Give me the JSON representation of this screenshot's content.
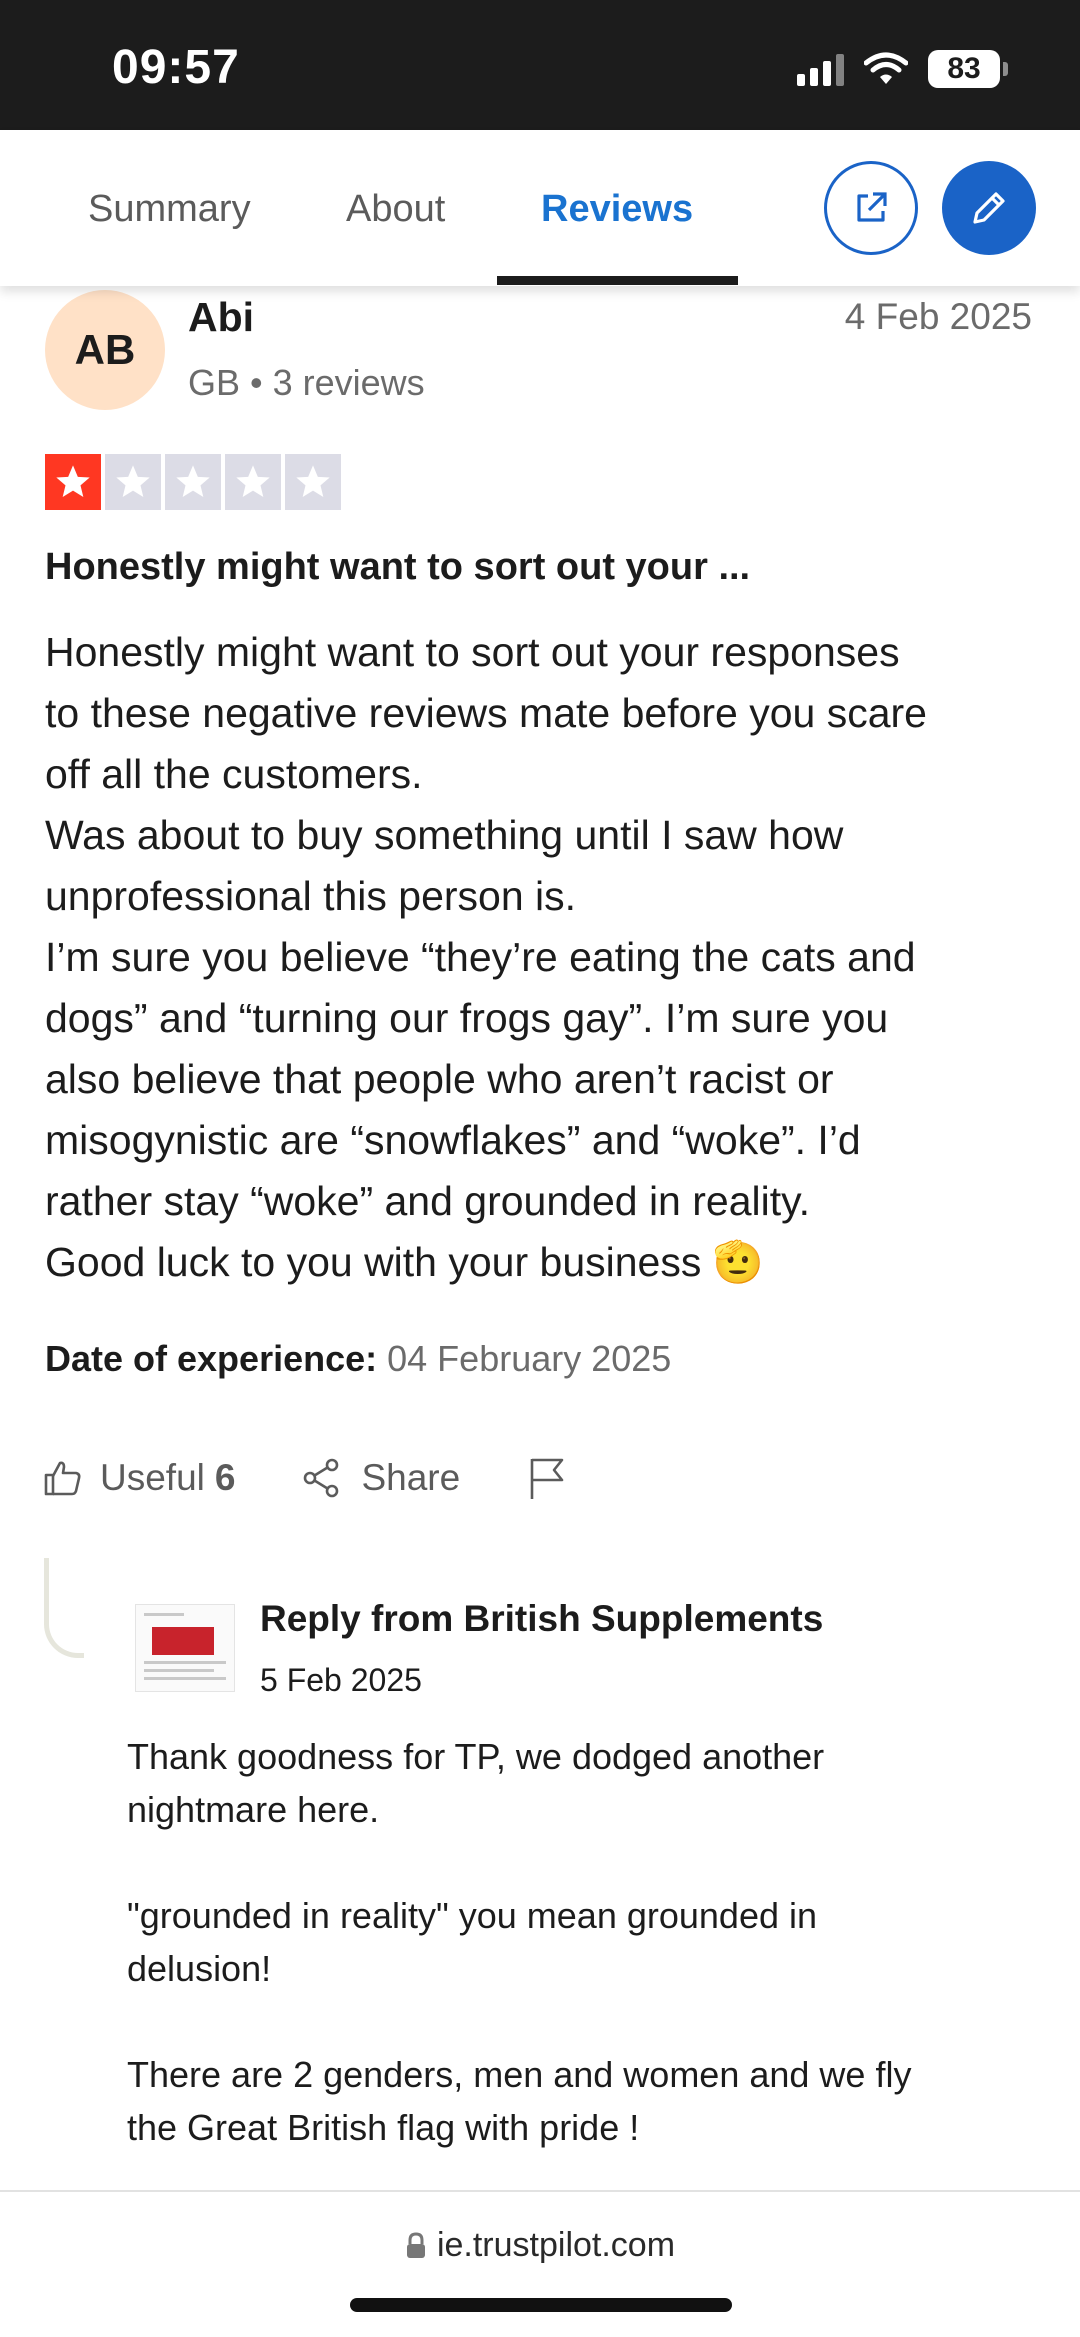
{
  "status_bar": {
    "time": "09:57",
    "battery": "83"
  },
  "nav": {
    "tabs": [
      {
        "label": "Summary"
      },
      {
        "label": "About"
      },
      {
        "label": "Reviews"
      }
    ],
    "active_tab": "Reviews",
    "external_icon": "external-link-icon",
    "write_icon": "pencil-icon",
    "accent": "#1a63c7"
  },
  "review": {
    "initials": "AB",
    "name": "Abi",
    "meta": "GB • 3 reviews",
    "date": "4 Feb 2025",
    "rating": 1,
    "rating_max": 5,
    "star_color": "#ff3722",
    "title": "Honestly might want to sort out your ...",
    "body_lines": [
      "Honestly might want to sort out your responses",
      "to these negative reviews mate before you scare",
      "off all the customers.",
      "Was about to buy something until I saw how",
      "unprofessional this person is.",
      "I’m sure you believe “they’re eating the cats and",
      "dogs” and “turning our frogs gay”. I’m sure you",
      "also believe that people who aren’t racist or",
      "misogynistic are “snowflakes” and “woke”. I’d",
      "rather stay “woke” and grounded in reality.",
      "Good luck to you with your business 🫡"
    ],
    "date_of_experience_label": "Date of experience:",
    "date_of_experience_value": "04 February 2025",
    "useful_label": "Useful",
    "useful_count": "6",
    "share_label": "Share"
  },
  "reply": {
    "from": "Reply from British Supplements",
    "date": "5 Feb 2025",
    "para1_lines": [
      "Thank goodness for TP, we dodged another",
      "nightmare here."
    ],
    "para2_lines": [
      "\"grounded in reality\" you mean grounded in",
      "delusion!"
    ],
    "para3_lines": [
      "There are 2 genders, men and women and we fly",
      "the Great British flag with pride !"
    ]
  },
  "browser": {
    "url": "ie.trustpilot.com"
  }
}
